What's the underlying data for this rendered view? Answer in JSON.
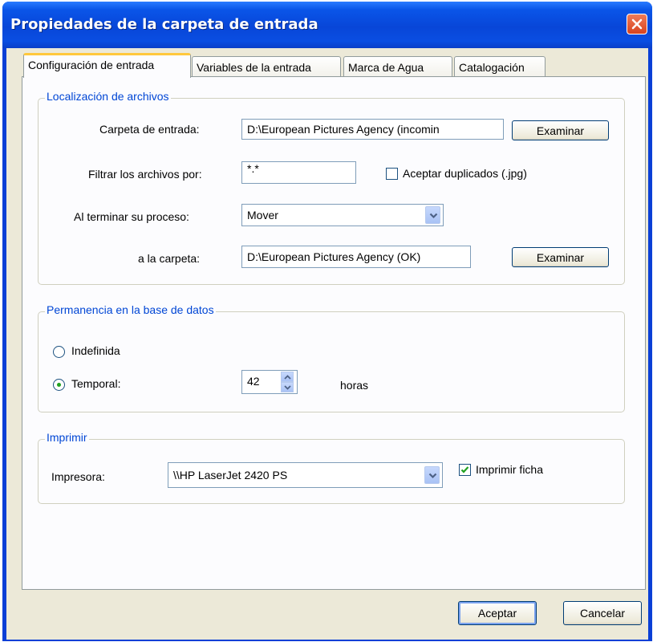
{
  "window": {
    "title": "Propiedades de la carpeta de entrada"
  },
  "tabs": [
    {
      "label": "Configuración de entrada",
      "active": true
    },
    {
      "label": "Variables de la entrada",
      "active": false
    },
    {
      "label": "Marca de Agua",
      "active": false
    },
    {
      "label": "Catalogación",
      "active": false
    }
  ],
  "files_group": {
    "legend": "Localización de archivos",
    "input_folder_label": "Carpeta de entrada:",
    "input_folder_value": "D:\\European Pictures Agency (incomin",
    "browse1_label": "Examinar",
    "filter_label": "Filtrar los archivos por:",
    "filter_value": "*.*",
    "accept_duplicates_label": "Aceptar duplicados (.jpg)",
    "accept_duplicates_checked": false,
    "on_finish_label": "Al terminar su proceso:",
    "on_finish_value": "Mover",
    "to_folder_label": "a la carpeta:",
    "to_folder_value": "D:\\European Pictures Agency (OK)",
    "browse2_label": "Examinar"
  },
  "db_group": {
    "legend": "Permanencia en la base de datos",
    "indefinite_label": "Indefinida",
    "indefinite_selected": false,
    "temporal_label": "Temporal:",
    "temporal_selected": true,
    "hours_value": "42",
    "hours_unit": "horas"
  },
  "print_group": {
    "legend": "Imprimir",
    "printer_label": "Impresora:",
    "printer_value": "\\\\HP LaserJet 2420 PS",
    "print_card_label": "Imprimir ficha",
    "print_card_checked": true
  },
  "footer": {
    "ok_label": "Aceptar",
    "cancel_label": "Cancelar"
  },
  "colors": {
    "titlebar": "#0a4ee2",
    "dialog_bg": "#ece9d8",
    "group_legend": "#0046d5",
    "active_tab_accent": "#ffc83c",
    "check_mark": "#21a121"
  },
  "icons": {
    "close": "close-icon",
    "dropdown": "chevron-down-icon",
    "spin_up": "chevron-up-icon",
    "spin_down": "chevron-down-icon",
    "check": "checkmark-icon"
  }
}
